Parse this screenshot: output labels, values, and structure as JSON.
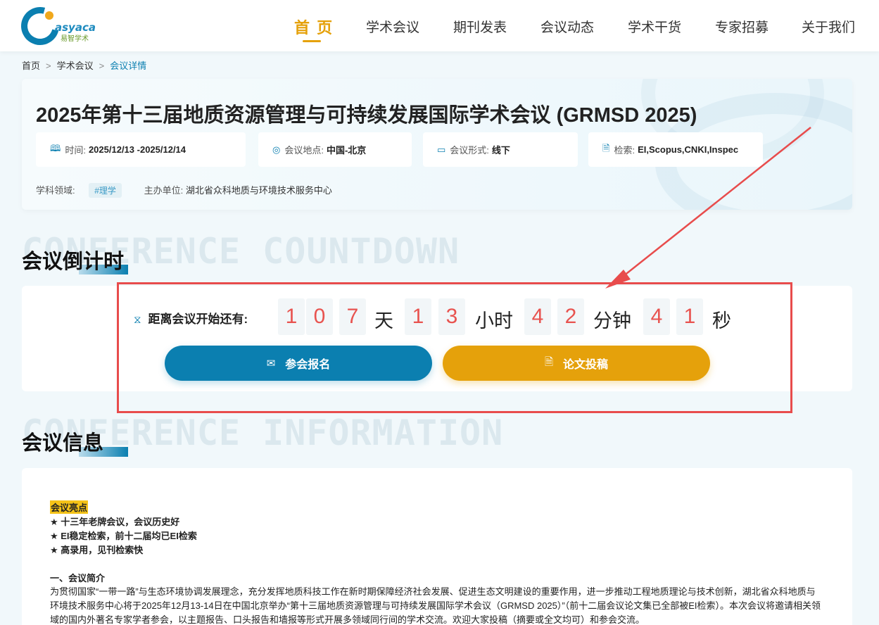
{
  "header": {
    "logo_text": "asyaca",
    "logo_sub": "易智学术",
    "nav": [
      {
        "label": "首 页",
        "active": true
      },
      {
        "label": "学术会议"
      },
      {
        "label": "期刊发表"
      },
      {
        "label": "会议动态"
      },
      {
        "label": "学术干货"
      },
      {
        "label": "专家招募"
      },
      {
        "label": "关于我们"
      }
    ]
  },
  "breadcrumb": {
    "home": "首页",
    "level2": "学术会议",
    "current": "会议详情",
    "separator": ">"
  },
  "conference": {
    "title": "2025年第十三届地质资源管理与可持续发展国际学术会议 (GRMSD 2025)",
    "time_label": "时间:",
    "time_value": "2025/12/13 -2025/12/14",
    "location_label": "会议地点:",
    "location_value": "中国-北京",
    "format_label": "会议形式:",
    "format_value": "线下",
    "index_label": "检索:",
    "index_value": "EI,Scopus,CNKI,Inspec",
    "subject_label": "学科领域:",
    "subject_tag": "#理学",
    "organizer_label": "主办单位:",
    "organizer_value": "湖北省众科地质与环境技术服务中心"
  },
  "countdown_section": {
    "bg_text": "CONFERENCE COUNTDOWN",
    "title": "会议倒计时",
    "label": "距离会议开始还有:",
    "days": [
      "1",
      "0",
      "7"
    ],
    "days_unit": "天",
    "hours": [
      "1",
      "3"
    ],
    "hours_unit": "小时",
    "minutes": [
      "4",
      "2"
    ],
    "minutes_unit": "分钟",
    "seconds": [
      "4",
      "1"
    ],
    "seconds_unit": "秒",
    "register_button": "参会报名",
    "submit_button": "论文投稿"
  },
  "info_section": {
    "bg_text": "CONFERENCE INFORMATION",
    "title": "会议信息",
    "highlights_title": "会议亮点",
    "highlights": [
      "★ 十三年老牌会议，会议历史好",
      "★ EI稳定检索，前十二届均已EI检索",
      "★ 高录用，见刊检索快"
    ],
    "intro_title": "一、会议简介",
    "intro_text": "为贯彻国家“一带一路”与生态环境协调发展理念，充分发挥地质科技工作在新时期保障经济社会发展、促进生态文明建设的重要作用，进一步推动工程地质理论与技术创新，湖北省众科地质与环境技术服务中心将于2025年12月13-14日在中国北京举办“第十三届地质资源管理与可持续发展国际学术会议（GRMSD 2025）”（前十二届会议论文集已全部被EI检索）。本次会议将邀请相关领域的国内外著名专家学者参会，以主题报告、口头报告和墙报等形式开展多领域同行间的学术交流。欢迎大家投稿（摘要或全文均可）和参会交流。"
  },
  "colors": {
    "primary": "#0b7fb0",
    "accent": "#e5a10b",
    "digit": "#e8534f",
    "annotation": "#e84c4c"
  }
}
